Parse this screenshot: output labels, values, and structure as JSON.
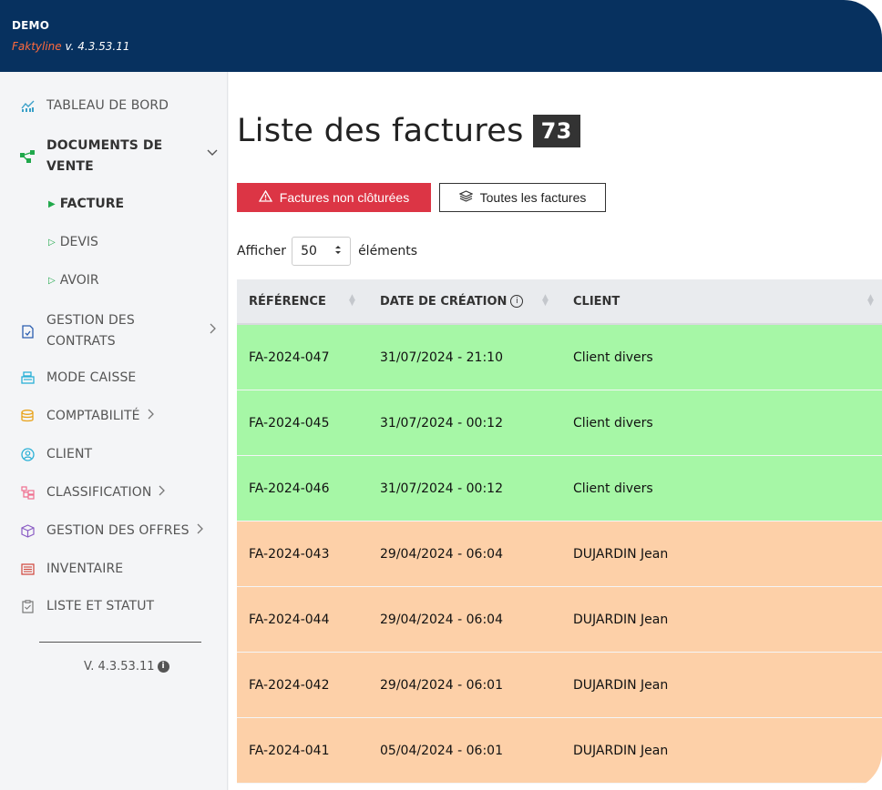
{
  "header": {
    "org": "DEMO",
    "brand": "Faktyline",
    "version": "v. 4.3.53.11"
  },
  "sidebar": {
    "items": [
      {
        "label": "TABLEAU DE BORD",
        "icon": "chart-icon"
      },
      {
        "label_line1": "DOCUMENTS DE",
        "label_line2": "VENTE",
        "icon": "network-icon",
        "chevron": "⌄"
      },
      {
        "label": "FACTURE",
        "active": true
      },
      {
        "label": "DEVIS"
      },
      {
        "label": "AVOIR"
      },
      {
        "label_line1": "GESTION DES",
        "label_line2": "CONTRATS",
        "icon": "contract-icon",
        "chevron": "›"
      },
      {
        "label": "MODE CAISSE",
        "icon": "cash-register-icon"
      },
      {
        "label": "COMPTABILITÉ",
        "icon": "coins-icon",
        "chevron": "›"
      },
      {
        "label": "CLIENT",
        "icon": "user-circle-icon"
      },
      {
        "label": "CLASSIFICATION",
        "icon": "hierarchy-icon",
        "chevron": "›"
      },
      {
        "label": "GESTION DES OFFRES",
        "icon": "box-icon",
        "chevron": "›"
      },
      {
        "label": "INVENTAIRE",
        "icon": "list-icon"
      },
      {
        "label": "LISTE ET STATUT",
        "icon": "clipboard-icon"
      }
    ],
    "version": "V. 4.3.53.11"
  },
  "main": {
    "title": "Liste des factures",
    "count": "73",
    "btn_open": "Factures non clôturées",
    "btn_all": "Toutes les factures",
    "show_prefix": "Afficher",
    "show_value": "50",
    "show_suffix": "éléments",
    "columns": [
      "RÉFÉRENCE",
      "DATE DE CRÉATION",
      "CLIENT"
    ],
    "rows": [
      {
        "ref": "FA-2024-047",
        "date": "31/07/2024 - 21:10",
        "client": "Client divers",
        "status": "green"
      },
      {
        "ref": "FA-2024-045",
        "date": "31/07/2024 - 00:12",
        "client": "Client divers",
        "status": "green"
      },
      {
        "ref": "FA-2024-046",
        "date": "31/07/2024 - 00:12",
        "client": "Client divers",
        "status": "green"
      },
      {
        "ref": "FA-2024-043",
        "date": "29/04/2024 - 06:04",
        "client": "DUJARDIN Jean",
        "status": "orange"
      },
      {
        "ref": "FA-2024-044",
        "date": "29/04/2024 - 06:04",
        "client": "DUJARDIN Jean",
        "status": "orange"
      },
      {
        "ref": "FA-2024-042",
        "date": "29/04/2024 - 06:01",
        "client": "DUJARDIN Jean",
        "status": "orange"
      },
      {
        "ref": "FA-2024-041",
        "date": "05/04/2024 - 06:01",
        "client": "DUJARDIN Jean",
        "status": "orange"
      }
    ]
  },
  "colors": {
    "topbar": "#07315f",
    "brand": "#ff6a3d",
    "accent_green": "#20a84b",
    "danger": "#dc3545",
    "row_green": "#a6f7a6",
    "row_orange": "#fdd0a8"
  }
}
